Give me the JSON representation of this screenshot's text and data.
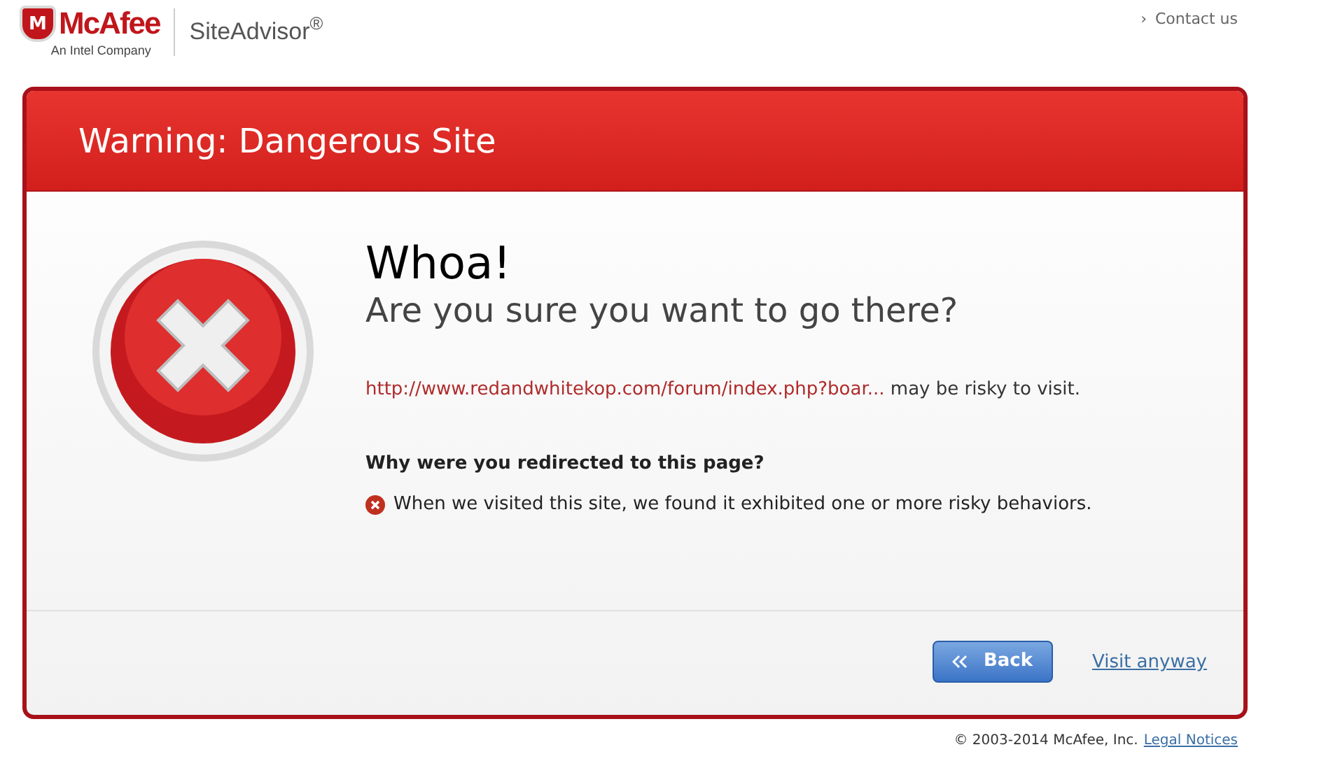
{
  "header": {
    "logo_mark": "M",
    "brand": "McAfee",
    "tagline": "An Intel Company",
    "product": "SiteAdvisor$^{®}$",
    "contact_arrow": "›",
    "contact": "Contact us"
  },
  "card": {
    "title": "Warning: Dangerous Site",
    "heading": "Whoa!",
    "subheading": "Are you sure you want to go there?",
    "url": "http://www.redandwhitekop.com/forum/index.php?boar...",
    "risk_text": "may be risky to visit.",
    "question": "Why were you redirected to this page?",
    "reasons": [
      "When we visited this site, we found it exhibited one or more risky behaviors."
    ],
    "back_button": "Back",
    "visit_link": "Visit anyway"
  },
  "footer": {
    "copyright": "© 2003-2014 McAfee, Inc.",
    "legal": "Legal Notices"
  }
}
